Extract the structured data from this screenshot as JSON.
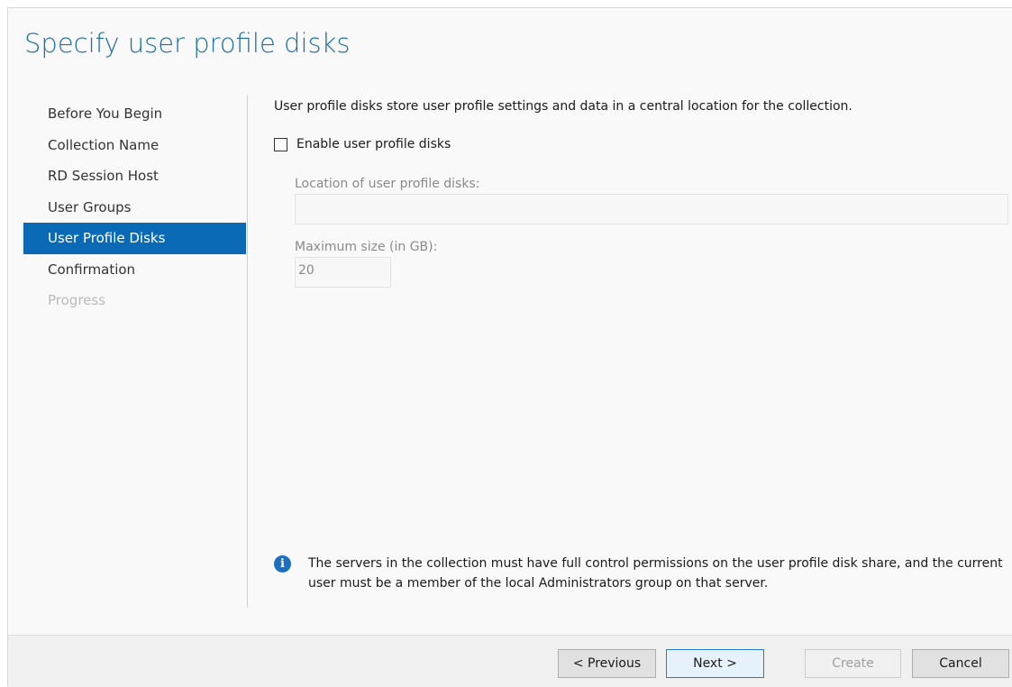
{
  "page": {
    "title": "Specify user profile disks"
  },
  "nav": {
    "items": [
      {
        "label": "Before You Begin",
        "state": "normal"
      },
      {
        "label": "Collection Name",
        "state": "normal"
      },
      {
        "label": "RD Session Host",
        "state": "normal"
      },
      {
        "label": "User Groups",
        "state": "normal"
      },
      {
        "label": "User Profile Disks",
        "state": "selected"
      },
      {
        "label": "Confirmation",
        "state": "normal"
      },
      {
        "label": "Progress",
        "state": "disabled"
      }
    ]
  },
  "main": {
    "description": "User profile disks store user profile settings and data in a central location for the collection.",
    "enable_checkbox": {
      "label": "Enable user profile disks",
      "checked": false
    },
    "location": {
      "label": "Location of user profile disks:",
      "value": ""
    },
    "max_size": {
      "label": "Maximum size (in GB):",
      "value": "20"
    },
    "info": {
      "icon": "info-icon",
      "text": "The servers in the collection must have full control permissions on the user profile disk share, and the current user must be a member of the local Administrators group on that server."
    }
  },
  "footer": {
    "previous_label": "< Previous",
    "next_label": "Next >",
    "create_label": "Create",
    "cancel_label": "Cancel"
  },
  "colors": {
    "title": "#1e6ea7",
    "selected_bg": "#0b6ab5",
    "info_icon": "#1a6fbf"
  }
}
